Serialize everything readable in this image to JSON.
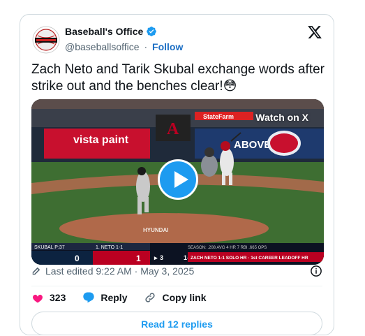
{
  "header": {
    "display_name": "Baseball's Office",
    "handle": "@baseballsoffice",
    "separator": "·",
    "follow_label": "Follow"
  },
  "tweet": {
    "text": "Zach Neto and Tarik Skubal exchange words after strike out and the benches clear!😳"
  },
  "media": {
    "watch_label": "Watch on X",
    "banner_left": "vista paint",
    "banner_center": "ABOVE",
    "statefarm": "StateFarm",
    "scoreboard": {
      "pitcher_label": "SKUBAL P:37",
      "batter_label": "1. NETO 1-1",
      "away_score": "0",
      "home_score": "1",
      "inning": "3",
      "count": "1-2",
      "season_line": "SEASON: .208 AVG  4 HR  7 RBI  .665 OPS",
      "bottom_line": "ZACH NETO  1-1 SOLO HR · 1st CAREER LEADOFF HR"
    },
    "mound_text": "HYUNDAI"
  },
  "meta": {
    "edited_text": "Last edited 9:22 AM · May 3, 2025"
  },
  "actions": {
    "like_count": "323",
    "reply_label": "Reply",
    "copy_label": "Copy link"
  },
  "replies_label": "Read 12 replies",
  "colors": {
    "accent": "#1d9bf0",
    "like": "#f91880",
    "follow": "#1d6fc4",
    "muted": "#536471"
  }
}
